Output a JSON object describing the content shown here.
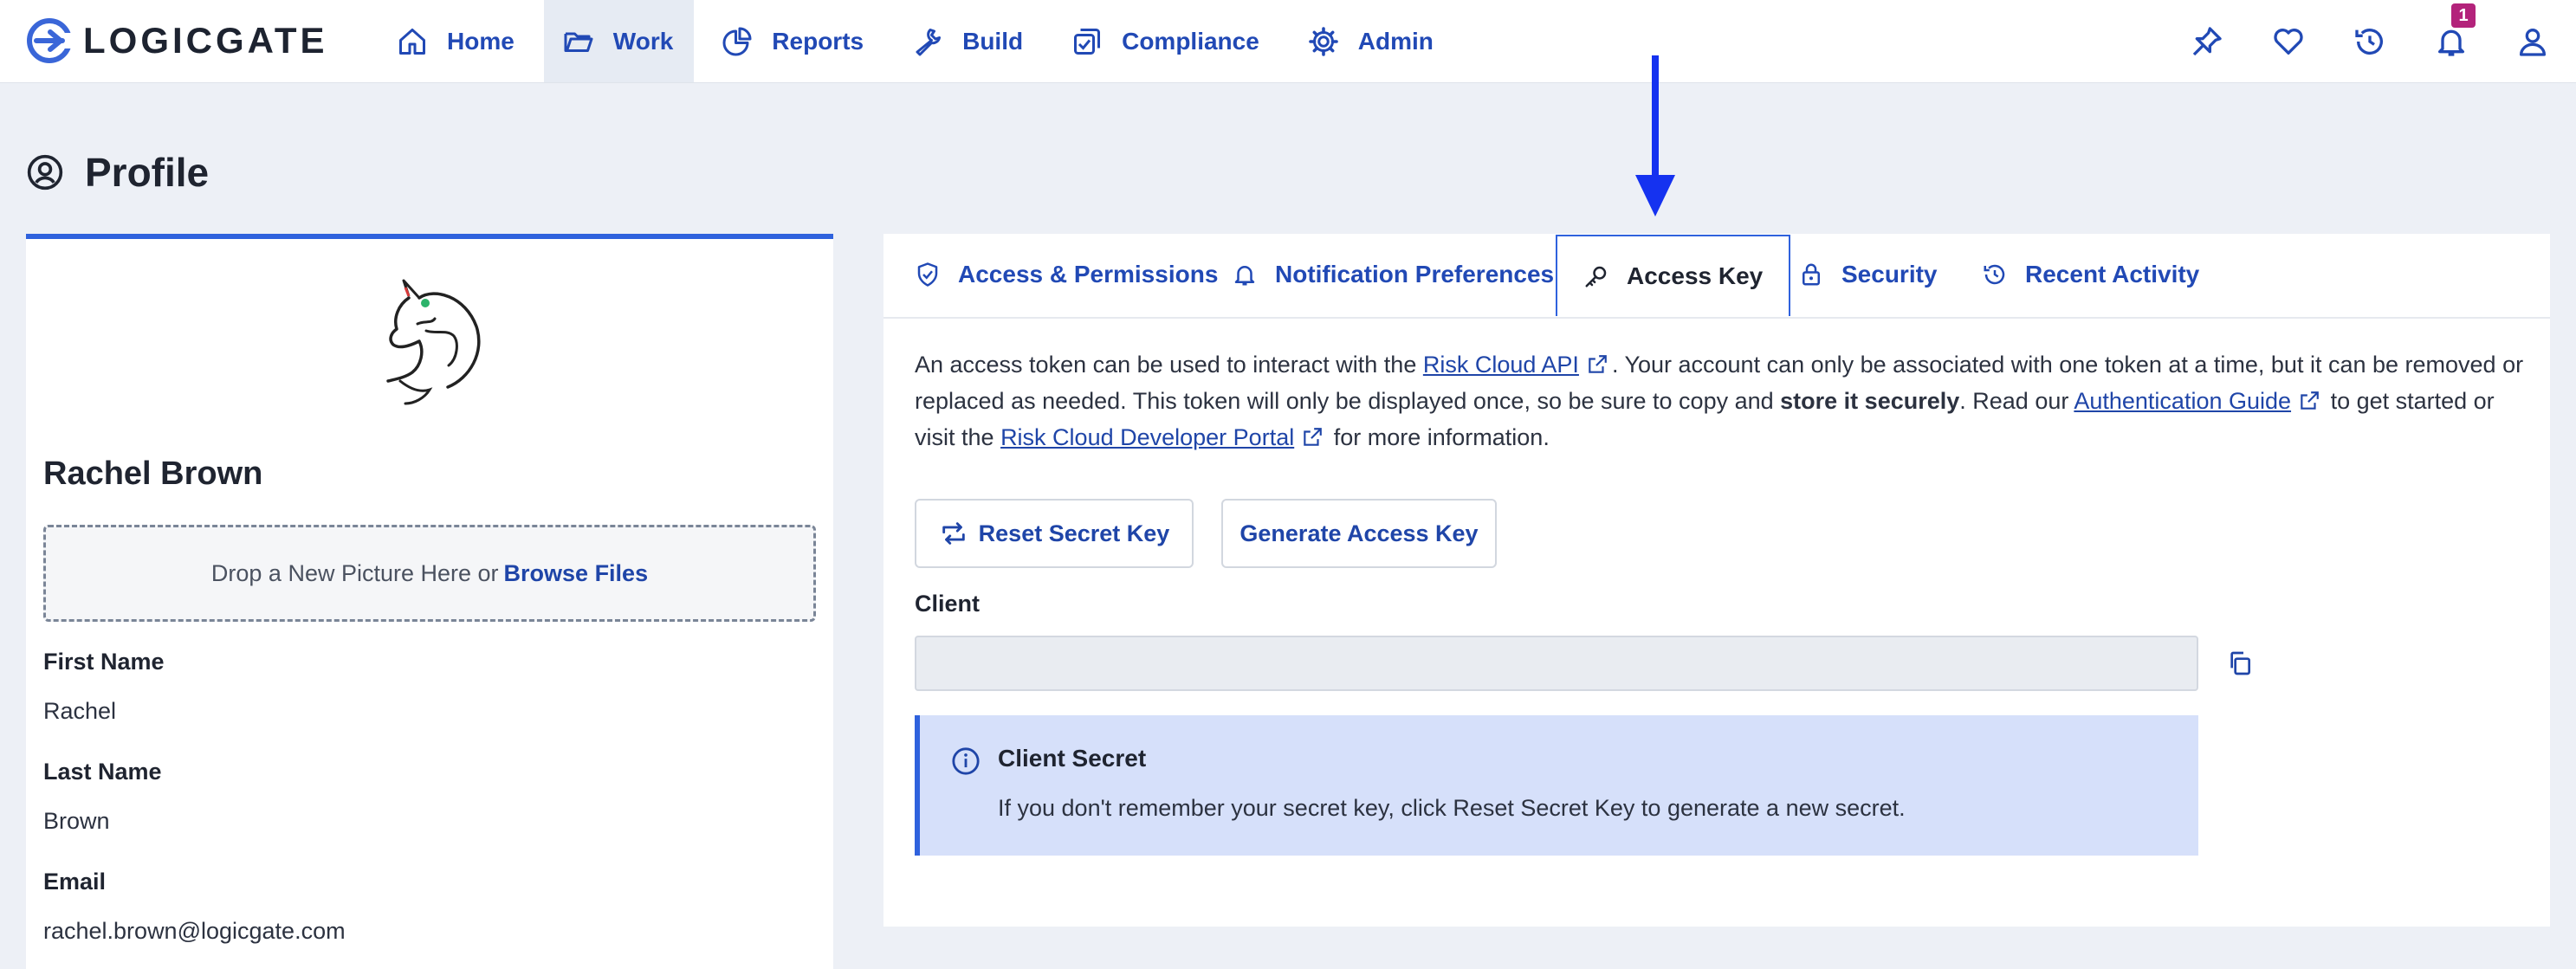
{
  "brand": {
    "name": "LOGICGATE",
    "logo_icon": "logicgate-logo-icon"
  },
  "nav": {
    "items": [
      {
        "label": "Home",
        "icon": "home-icon",
        "active": false
      },
      {
        "label": "Work",
        "icon": "folder-icon",
        "active": true
      },
      {
        "label": "Reports",
        "icon": "pie-chart-icon",
        "active": false
      },
      {
        "label": "Build",
        "icon": "wrench-icon",
        "active": false
      },
      {
        "label": "Compliance",
        "icon": "compliance-icon",
        "active": false
      },
      {
        "label": "Admin",
        "icon": "gear-icon",
        "active": false
      }
    ],
    "right_icons": [
      "pin-icon",
      "heart-icon",
      "history-icon",
      "bell-icon",
      "user-icon"
    ],
    "notification_count": "1"
  },
  "page": {
    "title": "Profile",
    "icon": "user-circle-icon"
  },
  "profile": {
    "name": "Rachel Brown",
    "dropzone_text": "Drop a New Picture Here or",
    "dropzone_link": "Browse Files",
    "fields": [
      {
        "label": "First Name",
        "value": "Rachel"
      },
      {
        "label": "Last Name",
        "value": "Brown"
      },
      {
        "label": "Email",
        "value": "rachel.brown@logicgate.com"
      }
    ]
  },
  "tabs": [
    {
      "label": "Access & Permissions",
      "icon": "shield-check-icon",
      "active": false
    },
    {
      "label": "Notification Preferences",
      "icon": "bell-icon",
      "active": false
    },
    {
      "label": "Access Key",
      "icon": "key-icon",
      "active": true
    },
    {
      "label": "Security",
      "icon": "lock-icon",
      "active": false
    },
    {
      "label": "Recent Activity",
      "icon": "history-icon",
      "active": false
    }
  ],
  "access_key": {
    "desc_1": "An access token can be used to interact with the",
    "link_api": "Risk Cloud API",
    "desc_2": ". Your account can only be associated with one token at a time, but it can be removed or replaced as needed. This token will only be displayed once, so be sure to copy and",
    "desc_bold": "store it securely",
    "desc_3": ". Read our",
    "link_auth": "Authentication Guide",
    "desc_4": "to get started or visit the",
    "link_portal": "Risk Cloud Developer Portal",
    "desc_5": "for more information.",
    "reset_button": "Reset Secret Key",
    "generate_button": "Generate Access Key",
    "client_label": "Client",
    "client_value": "",
    "callout_title": "Client Secret",
    "callout_text": "If you don't remember your secret key, click Reset Secret Key to generate a new secret."
  },
  "colors": {
    "accent": "#2f62dd",
    "link": "#1f45a8",
    "badge": "#b3237b",
    "callout_bg": "#d6e0fa",
    "annotation_arrow": "#1532f0"
  }
}
